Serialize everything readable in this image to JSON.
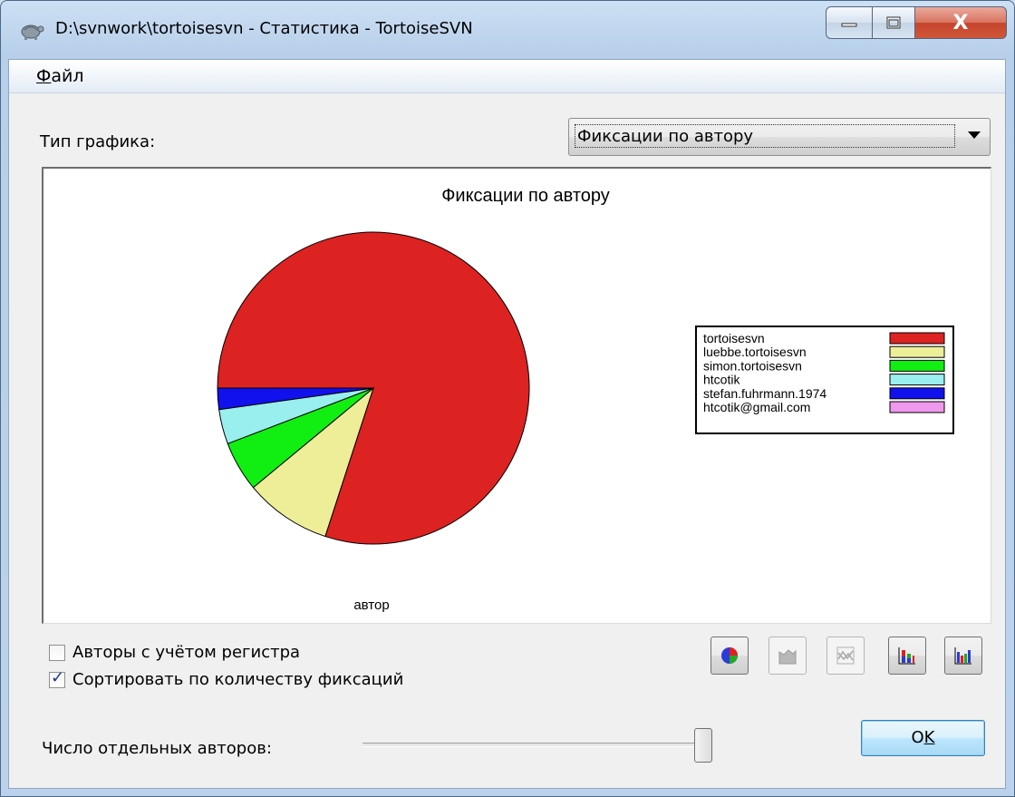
{
  "window": {
    "title": "D:\\svnwork\\tortoisesvn - Статистика - TortoiseSVN",
    "close_glyph": "X"
  },
  "menu": {
    "file_underlined": "Ф",
    "file_rest": "айл"
  },
  "controls": {
    "chart_type_label": "Тип графика:",
    "chart_type_value": "Фиксации по автору",
    "case_sensitive_label": "Авторы с учётом регистра",
    "case_sensitive_checked": false,
    "sort_by_commits_label": "Сортировать по количеству фиксаций",
    "sort_by_commits_checked": true,
    "authors_count_label": "Число отдельных авторов:",
    "authors_slider_fraction": 1.0,
    "ok_label_main": "O",
    "ok_label_underlined": "K"
  },
  "toolbar": {
    "buttons": [
      {
        "icon": "pie-chart-icon",
        "enabled": true
      },
      {
        "icon": "area-chart-icon",
        "enabled": false
      },
      {
        "icon": "line-chart-icon",
        "enabled": false
      },
      {
        "icon": "stacked-bar-chart-icon",
        "enabled": true
      },
      {
        "icon": "bar-chart-icon",
        "enabled": true
      }
    ]
  },
  "chart_data": {
    "type": "pie",
    "title": "Фиксации по автору",
    "xlabel": "автор",
    "legend_position": "right",
    "series": [
      {
        "name": "tortoisesvn",
        "value": 80.0,
        "color": "#dd2222"
      },
      {
        "name": "luebbe.tortoisesvn",
        "value": 9.0,
        "color": "#eeee99"
      },
      {
        "name": "simon.tortoisesvn",
        "value": 5.2,
        "color": "#11ee11"
      },
      {
        "name": "htcotik",
        "value": 3.6,
        "color": "#99eeee"
      },
      {
        "name": "stefan.fuhrmann.1974",
        "value": 2.2,
        "color": "#1111ee"
      },
      {
        "name": "htcotik@gmail.com",
        "value": 0.0,
        "color": "#ee99ee"
      }
    ]
  }
}
